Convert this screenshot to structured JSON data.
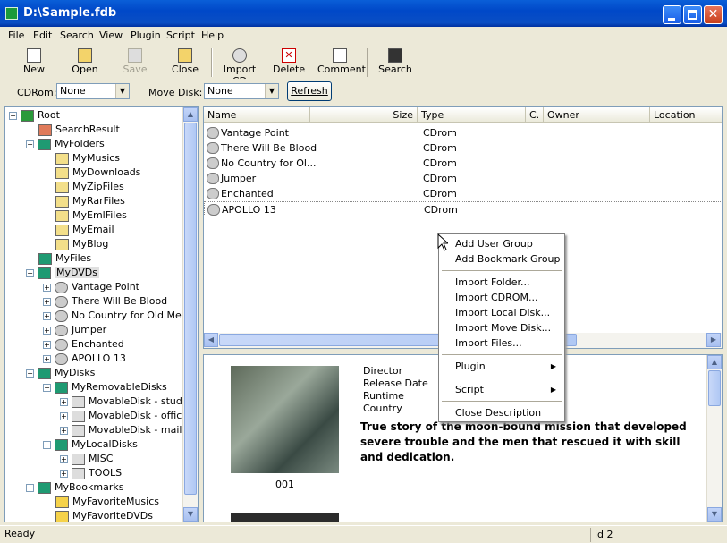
{
  "window": {
    "title": "D:\\Sample.fdb"
  },
  "menu": [
    "File",
    "Edit",
    "Search",
    "View",
    "Plugin",
    "Script",
    "Help"
  ],
  "toolbar": {
    "new": "New",
    "open": "Open",
    "save": "Save",
    "close": "Close",
    "import_cd": "Import CD",
    "delete": "Delete",
    "comment": "Comment",
    "search": "Search"
  },
  "filter": {
    "cdrom_label": "CDRom:",
    "cdrom_value": "None",
    "movedisk_label": "Move Disk:",
    "movedisk_value": "None",
    "refresh_label": "Refresh"
  },
  "tree": {
    "root": "Root",
    "search_result": "SearchResult",
    "my_folders": "MyFolders",
    "folder_items": [
      "MyMusics",
      "MyDownloads",
      "MyZipFiles",
      "MyRarFiles",
      "MyEmlFiles",
      "MyEmail",
      "MyBlog"
    ],
    "my_files": "MyFiles",
    "my_dvds": "MyDVDs",
    "dvd_items": [
      "Vantage Point",
      "There Will Be Blood",
      "No Country for Old Men",
      "Jumper",
      "Enchanted",
      "APOLLO 13"
    ],
    "my_disks": "MyDisks",
    "removable": "MyRemovableDisks",
    "removable_items": [
      "MovableDisk - study",
      "MovableDisk - office",
      "MovableDisk - mail"
    ],
    "local": "MyLocalDisks",
    "local_items": [
      "MISC",
      "TOOLS"
    ],
    "bookmarks": "MyBookmarks",
    "bookmark_items": [
      "MyFavoriteMusics",
      "MyFavoriteDVDs"
    ]
  },
  "list": {
    "columns": [
      "Name",
      "Size",
      "Type",
      "C.",
      "Owner",
      "Location"
    ],
    "rows": [
      {
        "name": "Vantage Point",
        "type": "CDrom"
      },
      {
        "name": "There Will Be Blood",
        "type": "CDrom"
      },
      {
        "name": "No Country for Ol...",
        "type": "CDrom"
      },
      {
        "name": "Jumper",
        "type": "CDrom"
      },
      {
        "name": "Enchanted",
        "type": "CDrom"
      },
      {
        "name": "APOLLO 13",
        "type": "CDrom"
      }
    ]
  },
  "context_menu": {
    "add_user_group": "Add User Group",
    "add_bookmark_group": "Add Bookmark Group",
    "import_folder": "Import Folder...",
    "import_cdrom": "Import CDROM...",
    "import_local_disk": "Import Local Disk...",
    "import_move_disk": "Import Move Disk...",
    "import_files": "Import Files...",
    "plugin": "Plugin",
    "script": "Script",
    "close_description": "Close Description"
  },
  "description": {
    "caption": "001",
    "fields": [
      "Director",
      "Release Date",
      "Runtime",
      "Country"
    ],
    "text": "True story of the moon-bound mission that developed severe trouble and the men that rescued it with skill and dedication."
  },
  "status": {
    "left": "Ready",
    "right": "id 2"
  }
}
